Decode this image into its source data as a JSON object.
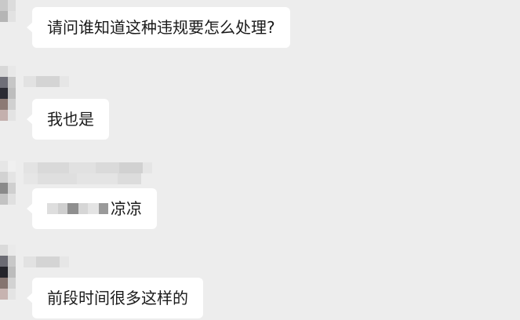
{
  "messages": [
    {
      "text": "请问谁知道这种违规要怎么处理?"
    },
    {
      "text": "我也是"
    },
    {
      "text": "凉凉"
    },
    {
      "text": "前段时间很多这样的"
    }
  ]
}
